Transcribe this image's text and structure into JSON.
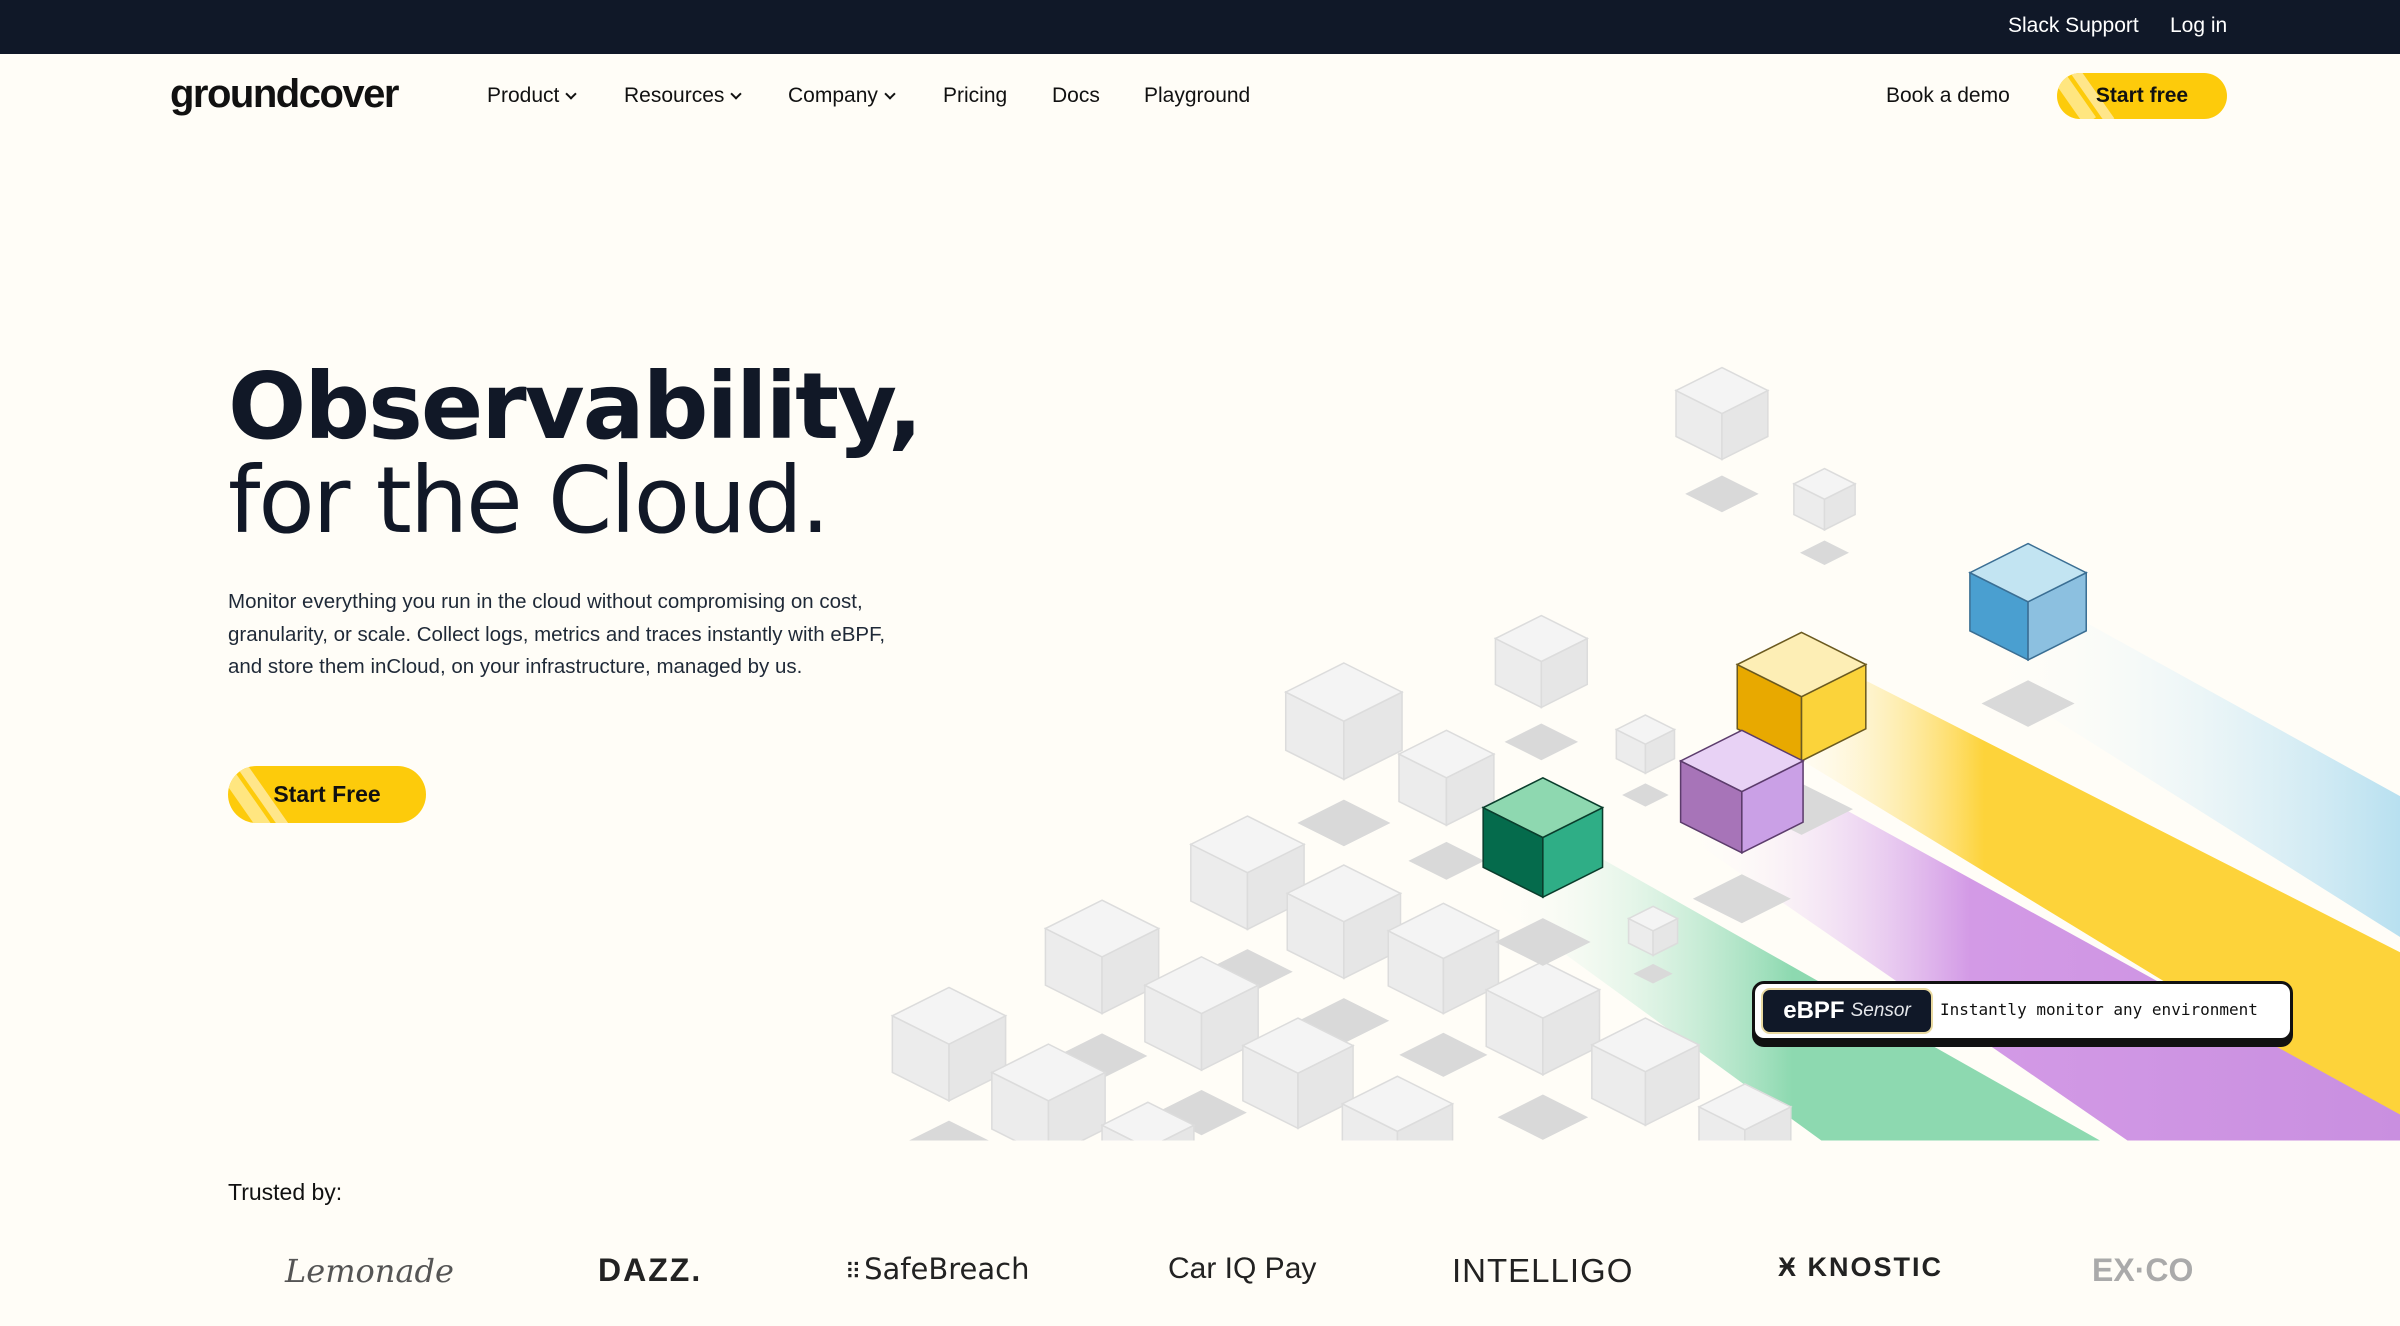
{
  "topbar": {
    "links": [
      "Slack Support",
      "Log in"
    ]
  },
  "nav": {
    "logo": "groundcover",
    "items": [
      {
        "label": "Product",
        "dropdown": true
      },
      {
        "label": "Resources",
        "dropdown": true
      },
      {
        "label": "Company",
        "dropdown": true
      },
      {
        "label": "Pricing"
      },
      {
        "label": "Docs"
      },
      {
        "label": "Playground"
      }
    ],
    "book_demo": "Book a demo",
    "start_free": "Start free"
  },
  "hero": {
    "title_line1": "Observability,",
    "title_line2": "for the Cloud.",
    "description": "Monitor everything you run in the cloud without compromising on cost, granularity, or scale. Collect logs, metrics and traces instantly with eBPF, and store them inCloud, on your infrastructure, managed by us.",
    "cta": "Start Free"
  },
  "badge": {
    "title": "eBPF",
    "subtitle": "Sensor",
    "text": "Instantly monitor any environment"
  },
  "colors": {
    "accent": "#fdcb0b",
    "topbar": "#101828",
    "blue": "#8ec3e6",
    "yellow": "#fdd33a",
    "purple": "#c98fe0",
    "green": "#8dd9b0"
  },
  "trusted": {
    "label": "Trusted by:",
    "logos": [
      "Lemonade",
      "DAZZ.",
      "SafeBreach",
      "Car IQ Pay",
      "INTELLIGO",
      "KNOSTIC",
      "EX·CO"
    ]
  }
}
